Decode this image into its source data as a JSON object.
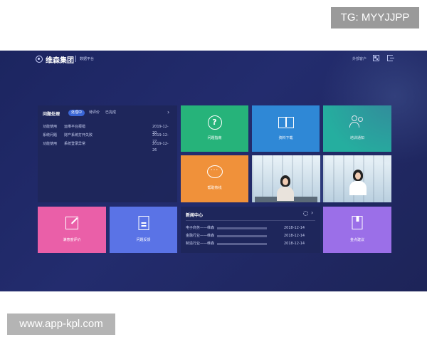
{
  "watermarks": {
    "top": "TG: MYYJJPP",
    "bottom": "www.app-kpl.com"
  },
  "header": {
    "brand": "维森集团",
    "subtitle": "数据平台",
    "external_link": "外部客户"
  },
  "issues": {
    "title": "问题处理",
    "tabs": [
      {
        "label": "处理中",
        "active": true
      },
      {
        "label": "待评价",
        "active": false
      },
      {
        "label": "已完成",
        "active": false
      }
    ],
    "rows": [
      {
        "type": "功能使用",
        "desc": "运维平台报错",
        "date": "2019-12-20"
      },
      {
        "type": "系统问题",
        "desc": "财产系统打开失败",
        "date": "2019-12-27"
      },
      {
        "type": "功能使用",
        "desc": "系统登录异常",
        "date": "2019-12-26"
      }
    ]
  },
  "tiles": {
    "help": {
      "label": "问题指南",
      "icon": "question-icon",
      "color": "#26b37a"
    },
    "download": {
      "label": "资料下载",
      "icon": "book-icon",
      "color": "#2f88d6"
    },
    "training": {
      "label": "培训通知",
      "icon": "people-icon",
      "color": "#25ae9f"
    },
    "hotline": {
      "label": "帮助热线",
      "icon": "chat-bubble-icon",
      "color": "#f0913a"
    },
    "satisfaction": {
      "label": "满意度评价",
      "icon": "edit-icon",
      "color": "#ea5fa8"
    },
    "feedback": {
      "label": "问题反馈",
      "icon": "document-icon",
      "color": "#5a73e6"
    },
    "ideas": {
      "label": "金点建议",
      "icon": "bookmark-icon",
      "color": "#9b6fe8"
    }
  },
  "news": {
    "title": "新闻中心",
    "rows": [
      {
        "label": "电子商务——维森",
        "date": "2018-12-14"
      },
      {
        "label": "金融行业——维森",
        "date": "2018-12-14"
      },
      {
        "label": "制造行业——维森",
        "date": "2018-12-14"
      }
    ]
  }
}
